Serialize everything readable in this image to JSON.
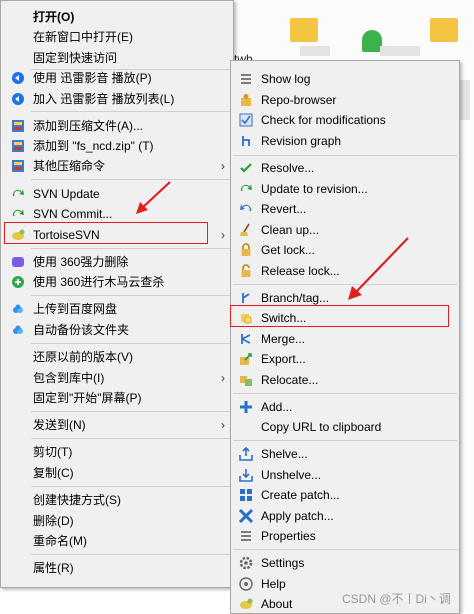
{
  "background": {
    "folder_label": "twb"
  },
  "main_menu": {
    "items": [
      {
        "label": "打开(O)",
        "icon": "none",
        "bold": true
      },
      {
        "label": "在新窗口中打开(E)",
        "icon": "none"
      },
      {
        "label": "固定到快速访问",
        "icon": "none"
      },
      {
        "label": "使用 迅雷影音 播放(P)",
        "icon": "xunlei-icon"
      },
      {
        "label": "加入 迅雷影音 播放列表(L)",
        "icon": "xunlei-icon"
      },
      {
        "label": "添加到压缩文件(A)...",
        "icon": "archive-icon"
      },
      {
        "label": "添加到 \"fs_ncd.zip\" (T)",
        "icon": "archive-icon"
      },
      {
        "label": "其他压缩命令",
        "icon": "archive-icon",
        "submenu": true
      },
      {
        "label": "SVN Update",
        "icon": "svn-update-icon"
      },
      {
        "label": "SVN Commit...",
        "icon": "svn-commit-icon"
      },
      {
        "label": "TortoiseSVN",
        "icon": "tortoise-icon",
        "submenu": true
      },
      {
        "label": "使用 360强力删除",
        "icon": "shield-360-icon"
      },
      {
        "label": "使用 360进行木马云查杀",
        "icon": "scan-360-icon"
      },
      {
        "label": "上传到百度网盘",
        "icon": "baidu-cloud-icon"
      },
      {
        "label": "自动备份该文件夹",
        "icon": "baidu-cloud-icon"
      },
      {
        "label": "还原以前的版本(V)",
        "icon": "none"
      },
      {
        "label": "包含到库中(I)",
        "icon": "none",
        "submenu": true
      },
      {
        "label": "固定到\"开始\"屏幕(P)",
        "icon": "none"
      },
      {
        "label": "发送到(N)",
        "icon": "none",
        "submenu": true
      },
      {
        "label": "剪切(T)",
        "icon": "none"
      },
      {
        "label": "复制(C)",
        "icon": "none"
      },
      {
        "label": "创建快捷方式(S)",
        "icon": "none"
      },
      {
        "label": "删除(D)",
        "icon": "none"
      },
      {
        "label": "重命名(M)",
        "icon": "none"
      },
      {
        "label": "属性(R)",
        "icon": "none"
      }
    ]
  },
  "svn_menu": {
    "items": [
      {
        "label": "Show log",
        "icon": "show-log-icon"
      },
      {
        "label": "Repo-browser",
        "icon": "repo-browser-icon"
      },
      {
        "label": "Check for modifications",
        "icon": "check-modifications-icon"
      },
      {
        "label": "Revision graph",
        "icon": "revision-graph-icon"
      },
      {
        "label": "Resolve...",
        "icon": "resolve-icon"
      },
      {
        "label": "Update to revision...",
        "icon": "update-revision-icon"
      },
      {
        "label": "Revert...",
        "icon": "revert-icon"
      },
      {
        "label": "Clean up...",
        "icon": "cleanup-icon"
      },
      {
        "label": "Get lock...",
        "icon": "lock-icon"
      },
      {
        "label": "Release lock...",
        "icon": "unlock-icon"
      },
      {
        "label": "Branch/tag...",
        "icon": "branch-icon"
      },
      {
        "label": "Switch...",
        "icon": "switch-icon"
      },
      {
        "label": "Merge...",
        "icon": "merge-icon"
      },
      {
        "label": "Export...",
        "icon": "export-icon"
      },
      {
        "label": "Relocate...",
        "icon": "relocate-icon"
      },
      {
        "label": "Add...",
        "icon": "add-icon"
      },
      {
        "label": "Copy URL to clipboard",
        "icon": "copy-url-icon"
      },
      {
        "label": "Shelve...",
        "icon": "shelve-icon"
      },
      {
        "label": "Unshelve...",
        "icon": "unshelve-icon"
      },
      {
        "label": "Create patch...",
        "icon": "create-patch-icon"
      },
      {
        "label": "Apply patch...",
        "icon": "apply-patch-icon"
      },
      {
        "label": "Properties",
        "icon": "properties-icon"
      },
      {
        "label": "Settings",
        "icon": "settings-icon"
      },
      {
        "label": "Help",
        "icon": "help-icon"
      },
      {
        "label": "About",
        "icon": "about-icon"
      }
    ]
  },
  "highlighted": [
    "TortoiseSVN",
    "Switch..."
  ],
  "colors": {
    "highlight_border": "#e02020",
    "arrow": "#e02020"
  },
  "watermark": "CSDN @不丨Di丶调"
}
